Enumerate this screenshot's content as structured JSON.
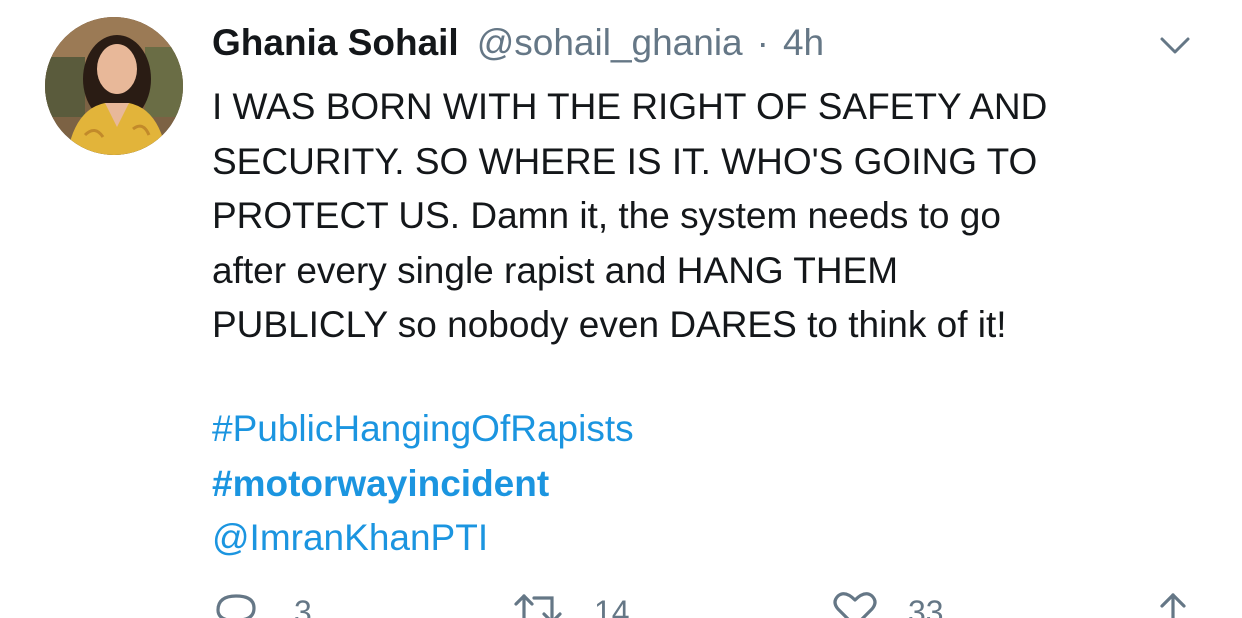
{
  "tweet": {
    "author": {
      "display_name": "Ghania Sohail",
      "handle": "@sohail_ghania",
      "separator": "·",
      "time": "4h"
    },
    "body_lines": [
      "I WAS BORN WITH THE RIGHT OF SAFETY AND",
      "SECURITY. SO WHERE IS IT. WHO'S GOING TO",
      "PROTECT US. Damn it, the system needs to go",
      "after every single rapist and HANG THEM",
      "PUBLICLY so nobody even DARES to think of it!"
    ],
    "hashtags": [
      "#PublicHangingOfRapists",
      "#motorwayincident"
    ],
    "mention": "@ImranKhanPTI",
    "actions": {
      "reply_count": "3",
      "retweet_count": "14",
      "like_count": "33"
    }
  },
  "icons": {
    "caret": "chevron-down-icon",
    "reply": "reply-icon",
    "retweet": "retweet-icon",
    "like": "heart-icon",
    "share": "share-icon"
  },
  "colors": {
    "link": "#1b95e0",
    "secondary_text": "#657786",
    "primary_text": "#14171a"
  }
}
